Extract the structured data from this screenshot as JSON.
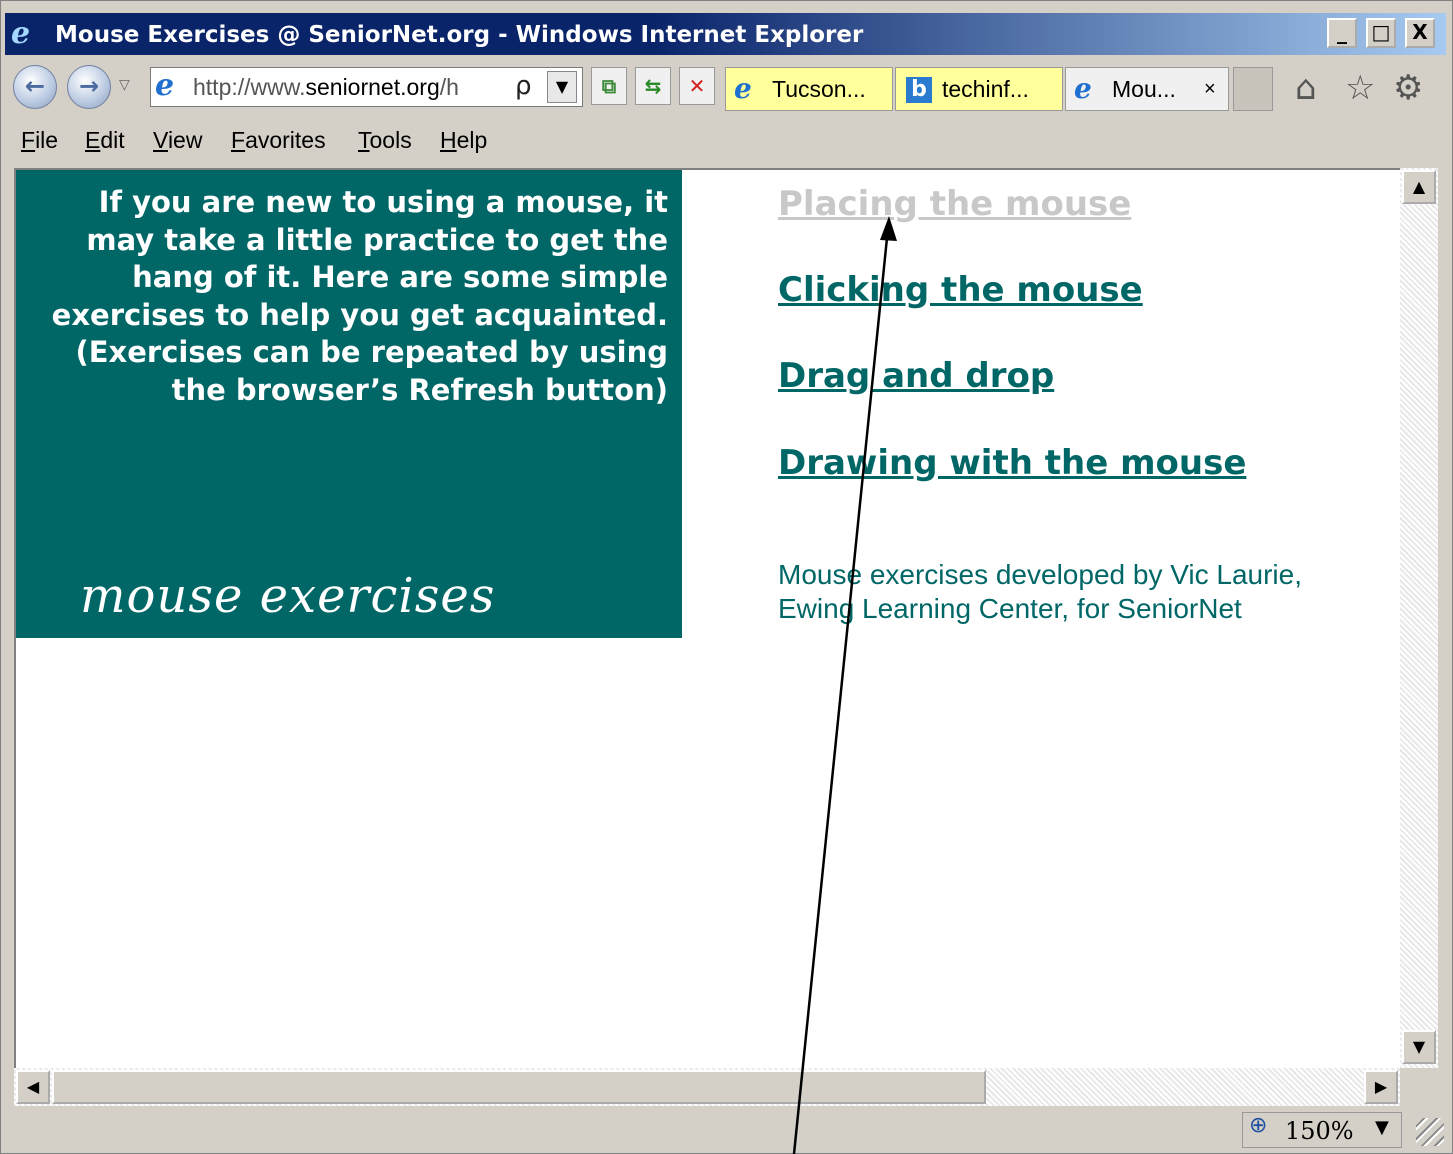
{
  "window": {
    "title": "Mouse Exercises @ SeniorNet.org - Windows Internet Explorer",
    "minimize_label": "_",
    "maximize_label": "□",
    "close_label": "X"
  },
  "nav": {
    "back_icon": "back-arrow",
    "forward_icon": "forward-arrow",
    "address_prefix": "http://www.",
    "address_domain": "seniornet.org",
    "address_suffix": "/h",
    "search_icon": "ρ",
    "dropdown_glyph": "▼",
    "tabs": [
      {
        "label": "Tucson...",
        "icon": "ie-icon",
        "bg": "#ffff9c"
      },
      {
        "label": "techinf...",
        "icon": "b-icon",
        "bg": "#ffff9c"
      },
      {
        "label": "Mou...",
        "icon": "ie-icon",
        "bg": "#f0f0f0",
        "close": "×"
      }
    ],
    "home_icon": "⌂",
    "favorites_icon": "☆",
    "settings_icon": "⚙"
  },
  "menu": {
    "items": [
      "File",
      "Edit",
      "View",
      "Favorites",
      "Tools",
      "Help"
    ]
  },
  "content": {
    "intro": "If you are new to using a mouse, it may take a little practice to get the hang of it. Here are some simple exercises to help you get acquainted. (Exercises can be repeated by using the browser’s Refresh button)",
    "logo_text": "mouse exercises",
    "links": [
      {
        "label": "Placing the mouse",
        "visited": true
      },
      {
        "label": "Clicking the mouse",
        "visited": false
      },
      {
        "label": "Drag and drop",
        "visited": false
      },
      {
        "label": "Drawing with the mouse",
        "visited": false
      }
    ],
    "credit": "Mouse exercises developed by Vic Laurie, Ewing Learning Center, for SeniorNet"
  },
  "status": {
    "zoom": "150%"
  },
  "colors": {
    "panel": "#006666",
    "link": "#006666",
    "visited_link": "#c8c8c8"
  }
}
